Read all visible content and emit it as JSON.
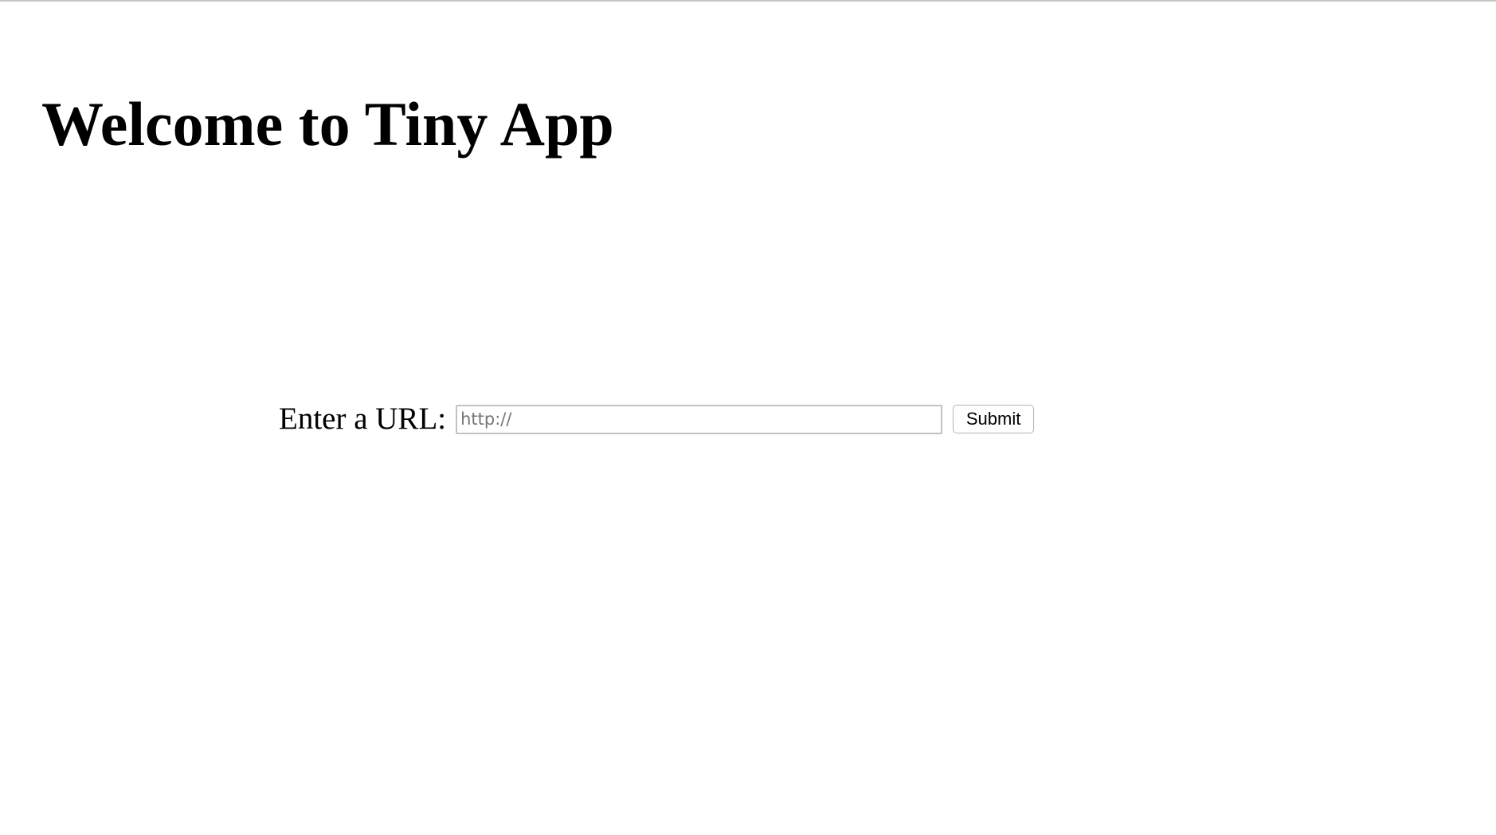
{
  "header": {
    "title": "Welcome to Tiny App"
  },
  "url_form": {
    "label": "Enter a URL:",
    "input_value": "",
    "input_placeholder": "http://",
    "submit_label": "Submit"
  }
}
